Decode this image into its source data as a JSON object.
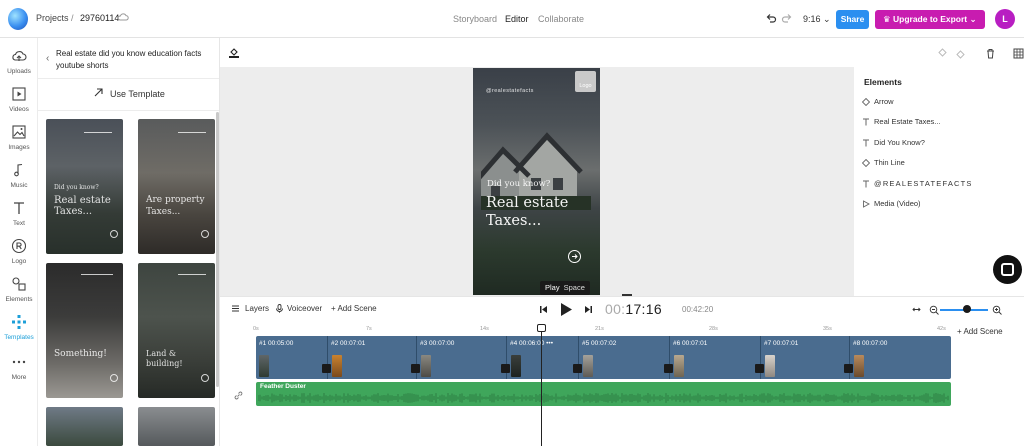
{
  "topbar": {
    "projects_label": "Projects",
    "separator": "/",
    "project_id": "29760114",
    "modes": [
      "Storyboard",
      "Editor",
      "Collaborate"
    ],
    "active_mode": "Editor",
    "ratio": "9:16",
    "share_label": "Share",
    "upgrade_label": "Upgrade to Export",
    "avatar_initial": "L",
    "upgrade_color": "#c81cb0",
    "share_color": "#2b8ff0"
  },
  "rail": {
    "items": [
      {
        "label": "Uploads",
        "icon": "upload-cloud-icon"
      },
      {
        "label": "Videos",
        "icon": "video-icon"
      },
      {
        "label": "Images",
        "icon": "image-icon"
      },
      {
        "label": "Music",
        "icon": "music-note-icon"
      },
      {
        "label": "Text",
        "icon": "text-icon"
      },
      {
        "label": "Logo",
        "icon": "registered-icon"
      },
      {
        "label": "Elements",
        "icon": "shapes-icon"
      },
      {
        "label": "Templates",
        "icon": "templates-icon"
      },
      {
        "label": "More",
        "icon": "more-dots-icon"
      }
    ],
    "active": "Templates",
    "accent": "#1d9fd8"
  },
  "panel": {
    "title": "Real estate did you know education facts youtube shorts",
    "use_template_label": "Use Template",
    "thumbnails": [
      {
        "line1": "Did you know?",
        "line2": "Real estate",
        "line3": "Taxes..."
      },
      {
        "line1": "",
        "line2": "Are property",
        "line3": "Taxes..."
      },
      {
        "line1": "",
        "line2": "Something!",
        "line3": ""
      },
      {
        "line1": "",
        "line2": "Land & building!",
        "line3": ""
      }
    ]
  },
  "canvas": {
    "handle": "@realestatefacts",
    "logo_label": "Logo",
    "subtitle": "Did you know?",
    "title": "Real estate Taxes...",
    "tooltip_action": "Play",
    "tooltip_key": "Space"
  },
  "elements": {
    "heading": "Elements",
    "items": [
      {
        "label": "Arrow",
        "icon": "shape-icon"
      },
      {
        "label": "Real Estate Taxes...",
        "icon": "text-icon"
      },
      {
        "label": "Did You Know?",
        "icon": "text-icon"
      },
      {
        "label": "Thin Line",
        "icon": "shape-icon"
      },
      {
        "label": "@REALESTATEFACTS",
        "icon": "text-icon"
      },
      {
        "label": "Media (Video)",
        "icon": "play-icon"
      }
    ]
  },
  "timeline": {
    "layers_label": "Layers",
    "voiceover_label": "Voiceover",
    "add_scene_label": "+ Add Scene",
    "current_time_prefix": "00:",
    "current_time_main": "17:16",
    "total_time": "00:42:20",
    "zoom_level": 0.65,
    "ruler": [
      "0s",
      "7s",
      "14s",
      "21s",
      "28s",
      "35s",
      "42s"
    ],
    "add_scene_right": "Add Scene",
    "clips": [
      {
        "label": "#1  00:05:00"
      },
      {
        "label": "#2  00:07:01"
      },
      {
        "label": "#3  00:07:00"
      },
      {
        "label": "#4  00:06:00   •••"
      },
      {
        "label": "#5  00:07:02"
      },
      {
        "label": "#6  00:07:01"
      },
      {
        "label": "#7  00:07:01"
      },
      {
        "label": "#8  00:07:00"
      }
    ],
    "audio_label": "Feather Duster"
  }
}
